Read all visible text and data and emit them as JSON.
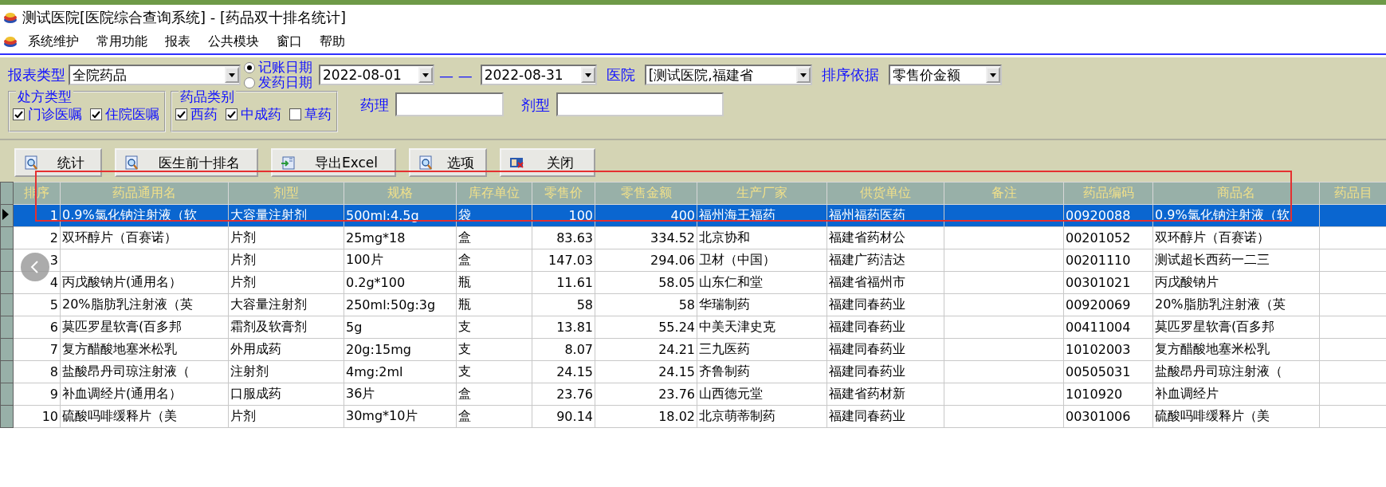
{
  "window": {
    "title": "测试医院[医院综合查询系统] - [药品双十排名统计]"
  },
  "menu": [
    "系统维护",
    "常用功能",
    "报表",
    "公共模块",
    "窗口",
    "帮助"
  ],
  "filters": {
    "report_type": {
      "label": "报表类型",
      "value": "全院药品"
    },
    "date_modes": [
      {
        "label": "记账日期",
        "selected": true
      },
      {
        "label": "发药日期",
        "selected": false
      }
    ],
    "date_from": "2022-08-01",
    "date_separator": "— —",
    "date_to": "2022-08-31",
    "hospital": {
      "label": "医院",
      "value": "[测试医院,福建省"
    },
    "sort": {
      "label": "排序依据",
      "value": "零售价金额"
    },
    "groups": [
      {
        "title": "处方类型",
        "options": [
          {
            "label": "门诊医嘱",
            "checked": true
          },
          {
            "label": "住院医嘱",
            "checked": true
          }
        ]
      },
      {
        "title": "药品类别",
        "options": [
          {
            "label": "西药",
            "checked": true
          },
          {
            "label": "中成药",
            "checked": true
          },
          {
            "label": "草药",
            "checked": false
          }
        ]
      }
    ],
    "fields": [
      {
        "label": "药理"
      },
      {
        "label": "剂型"
      }
    ]
  },
  "buttons": [
    {
      "label": "统计",
      "kind": "search"
    },
    {
      "label": "医生前十排名",
      "kind": "search"
    },
    {
      "label": "导出Excel",
      "kind": "export"
    },
    {
      "label": "选项",
      "kind": "search"
    },
    {
      "label": "关闭",
      "kind": "close"
    }
  ],
  "table": {
    "columns": [
      {
        "label": "排序",
        "kind": "number"
      },
      {
        "label": "药品通用名",
        "kind": "text"
      },
      {
        "label": "剂型",
        "kind": "text"
      },
      {
        "label": "规格",
        "kind": "text"
      },
      {
        "label": "库存单位",
        "kind": "text"
      },
      {
        "label": "零售价",
        "kind": "number"
      },
      {
        "label": "零售金额",
        "kind": "number"
      },
      {
        "label": "生产厂家",
        "kind": "text"
      },
      {
        "label": "供货单位",
        "kind": "text"
      },
      {
        "label": "备注",
        "kind": "text"
      },
      {
        "label": "药品编码",
        "kind": "text"
      },
      {
        "label": "商品名",
        "kind": "text"
      },
      {
        "label": "药品目",
        "kind": "text"
      }
    ],
    "rows": [
      {
        "selected": true,
        "cells": [
          "1",
          "0.9%氯化钠注射液（软",
          "大容量注射剂",
          "500ml:4.5g",
          "袋",
          "100",
          "400",
          "福州海王福药",
          "福州福药医药",
          "",
          "00920088",
          "0.9%氯化钠注射液（软",
          ""
        ]
      },
      {
        "selected": false,
        "cells": [
          "2",
          "双环醇片（百赛诺）",
          "片剂",
          "25mg*18",
          "盒",
          "83.63",
          "334.52",
          "北京协和",
          "福建省药材公",
          "",
          "00201052",
          "双环醇片（百赛诺）",
          ""
        ]
      },
      {
        "selected": false,
        "cells": [
          "3",
          "",
          "片剂",
          "100片",
          "盒",
          "147.03",
          "294.06",
          "卫材（中国）",
          "福建广药洁达",
          "",
          "00201110",
          "测试超长西药一二三",
          ""
        ]
      },
      {
        "selected": false,
        "cells": [
          "4",
          "丙戊酸钠片(通用名）",
          "片剂",
          "0.2g*100",
          "瓶",
          "11.61",
          "58.05",
          "山东仁和堂",
          "福建省福州市",
          "",
          "00301021",
          "丙戊酸钠片",
          ""
        ]
      },
      {
        "selected": false,
        "cells": [
          "5",
          "20%脂肪乳注射液（英",
          "大容量注射剂",
          "250ml:50g:3g",
          "瓶",
          "58",
          "58",
          "华瑞制药",
          "福建同春药业",
          "",
          "00920069",
          "20%脂肪乳注射液（英",
          ""
        ]
      },
      {
        "selected": false,
        "cells": [
          "6",
          "莫匹罗星软膏(百多邦",
          "霜剂及软膏剂",
          "5g",
          "支",
          "13.81",
          "55.24",
          "中美天津史克",
          "福建同春药业",
          "",
          "00411004",
          "莫匹罗星软膏(百多邦",
          ""
        ]
      },
      {
        "selected": false,
        "cells": [
          "7",
          "复方醋酸地塞米松乳",
          "外用成药",
          "20g:15mg",
          "支",
          "8.07",
          "24.21",
          "三九医药",
          "福建同春药业",
          "",
          "10102003",
          "复方醋酸地塞米松乳",
          ""
        ]
      },
      {
        "selected": false,
        "cells": [
          "8",
          "盐酸昂丹司琼注射液（",
          "注射剂",
          "4mg:2ml",
          "支",
          "24.15",
          "24.15",
          "齐鲁制药",
          "福建同春药业",
          "",
          "00505031",
          "盐酸昂丹司琼注射液（",
          ""
        ]
      },
      {
        "selected": false,
        "cells": [
          "9",
          "补血调经片(通用名）",
          "口服成药",
          "36片",
          "盒",
          "23.76",
          "23.76",
          "山西德元堂",
          "福建省药材新",
          "",
          "1010920",
          "补血调经片",
          ""
        ]
      },
      {
        "selected": false,
        "cells": [
          "10",
          "硫酸吗啡缓释片（美",
          "片剂",
          "30mg*10片",
          "盒",
          "90.14",
          "18.02",
          "北京萌蒂制药",
          "福建同春药业",
          "",
          "00301006",
          "硫酸吗啡缓释片（美",
          ""
        ]
      }
    ]
  }
}
